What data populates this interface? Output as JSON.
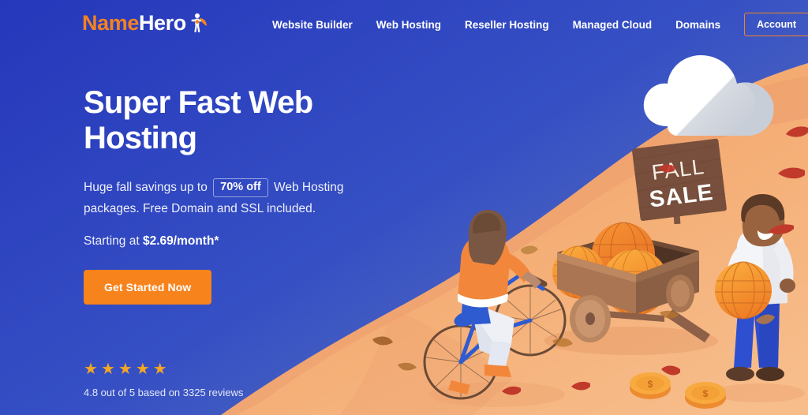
{
  "brand": {
    "name_part1": "Name",
    "name_part2": "Hero",
    "mark": "hero-figure-icon",
    "color_orange": "#f58220",
    "color_blue": "#2537bb"
  },
  "nav": {
    "items": [
      {
        "label": "Website Builder"
      },
      {
        "label": "Web Hosting"
      },
      {
        "label": "Reseller Hosting"
      },
      {
        "label": "Managed Cloud"
      },
      {
        "label": "Domains"
      }
    ],
    "account_label": "Account"
  },
  "hero": {
    "headline_line1": "Super Fast Web",
    "headline_line2": "Hosting",
    "sub_before": "Huge fall savings up to",
    "sub_badge": "70% off",
    "sub_after": "Web Hosting packages. Free Domain and SSL included.",
    "price_prefix": "Starting at",
    "price_value": "$2.69/month*",
    "cta_label": "Get Started Now"
  },
  "reviews": {
    "stars": [
      "★",
      "★",
      "★",
      "★",
      "★"
    ],
    "summary": "4.8 out of 5 based on 3325 reviews"
  },
  "illustration": {
    "sign_line1": "FALL",
    "sign_line2": "SALE",
    "coin_symbol": "$",
    "elements": [
      "cloud",
      "orange-hill",
      "fall-sale-sign",
      "wooden-cart",
      "pumpkin-globes",
      "woman-on-bicycle",
      "man-holding-globe",
      "falling-leaves",
      "gold-coins"
    ]
  }
}
